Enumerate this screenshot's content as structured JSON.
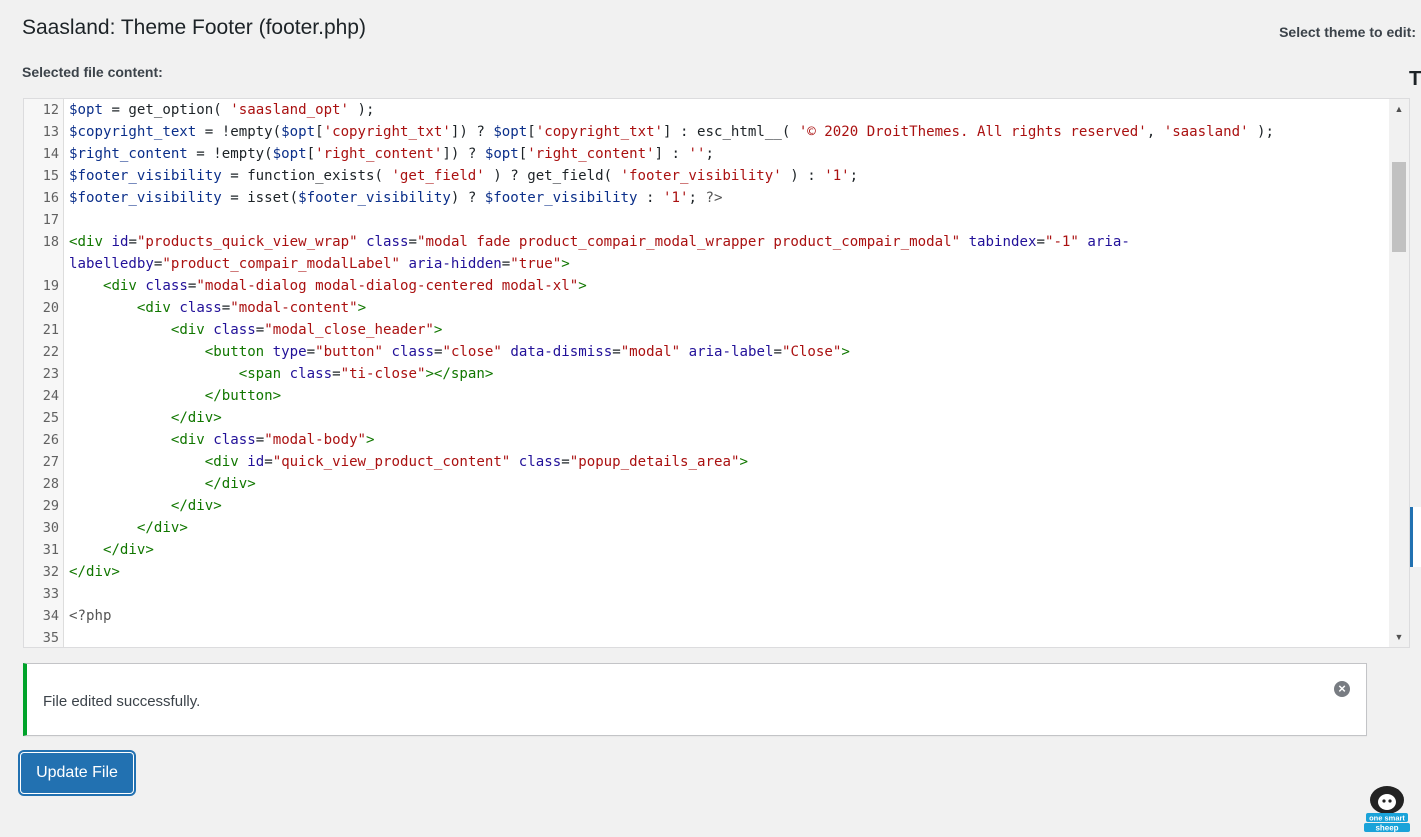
{
  "header": {
    "title": "Saasland: Theme Footer (footer.php)",
    "theme_select_label": "Select theme to edit:",
    "sidebar_heading_letter": "T"
  },
  "editor": {
    "label": "Selected file content:",
    "lines": [
      {
        "n": "12",
        "html": "<span class=\"v\">$opt</span> = get_option( <span class=\"s\">'saasland_opt'</span> );"
      },
      {
        "n": "13",
        "html": "<span class=\"v\">$copyright_text</span> = !empty(<span class=\"v\">$opt</span>[<span class=\"s\">'copyright_txt'</span>]) ? <span class=\"v\">$opt</span>[<span class=\"s\">'copyright_txt'</span>] : esc_html__( <span class=\"s\">'© 2020 DroitThemes. All rights reserved'</span>, <span class=\"s\">'saasland'</span> );"
      },
      {
        "n": "14",
        "html": "<span class=\"v\">$right_content</span> = !empty(<span class=\"v\">$opt</span>[<span class=\"s\">'right_content'</span>]) ? <span class=\"v\">$opt</span>[<span class=\"s\">'right_content'</span>] : <span class=\"s\">''</span>;"
      },
      {
        "n": "15",
        "html": "<span class=\"v\">$footer_visibility</span> = function_exists( <span class=\"s\">'get_field'</span> ) ? get_field( <span class=\"s\">'footer_visibility'</span> ) : <span class=\"s\">'1'</span>;"
      },
      {
        "n": "16",
        "html": "<span class=\"v\">$footer_visibility</span> = isset(<span class=\"v\">$footer_visibility</span>) ? <span class=\"v\">$footer_visibility</span> : <span class=\"s\">'1'</span>; <span class=\"m\">?&gt;</span>"
      },
      {
        "n": "17",
        "html": ""
      },
      {
        "n": "18",
        "tall": true,
        "html": "<span class=\"tg\">&lt;div</span> <span class=\"at\">id</span>=<span class=\"av\">\"products_quick_view_wrap\"</span> <span class=\"at\">class</span>=<span class=\"av\">\"modal fade product_compair_modal_wrapper product_compair_modal\"</span> <span class=\"at\">tabindex</span>=<span class=\"av\">\"-1\"</span> <span class=\"at\">aria-\nlabelledby</span>=<span class=\"av\">\"product_compair_modalLabel\"</span> <span class=\"at\">aria-hidden</span>=<span class=\"av\">\"true\"</span><span class=\"tg\">&gt;</span>"
      },
      {
        "n": "19",
        "html": "    <span class=\"tg\">&lt;div</span> <span class=\"at\">class</span>=<span class=\"av\">\"modal-dialog modal-dialog-centered modal-xl\"</span><span class=\"tg\">&gt;</span>"
      },
      {
        "n": "20",
        "html": "        <span class=\"tg\">&lt;div</span> <span class=\"at\">class</span>=<span class=\"av\">\"modal-content\"</span><span class=\"tg\">&gt;</span>"
      },
      {
        "n": "21",
        "html": "            <span class=\"tg\">&lt;div</span> <span class=\"at\">class</span>=<span class=\"av\">\"modal_close_header\"</span><span class=\"tg\">&gt;</span>"
      },
      {
        "n": "22",
        "html": "                <span class=\"tg\">&lt;button</span> <span class=\"at\">type</span>=<span class=\"av\">\"button\"</span> <span class=\"at\">class</span>=<span class=\"av\">\"close\"</span> <span class=\"at\">data-dismiss</span>=<span class=\"av\">\"modal\"</span> <span class=\"at\">aria-label</span>=<span class=\"av\">\"Close\"</span><span class=\"tg\">&gt;</span>"
      },
      {
        "n": "23",
        "html": "                    <span class=\"tg\">&lt;span</span> <span class=\"at\">class</span>=<span class=\"av\">\"ti-close\"</span><span class=\"tg\">&gt;&lt;/span&gt;</span>"
      },
      {
        "n": "24",
        "html": "                <span class=\"tg\">&lt;/button&gt;</span>"
      },
      {
        "n": "25",
        "html": "            <span class=\"tg\">&lt;/div&gt;</span>"
      },
      {
        "n": "26",
        "html": "            <span class=\"tg\">&lt;div</span> <span class=\"at\">class</span>=<span class=\"av\">\"modal-body\"</span><span class=\"tg\">&gt;</span>"
      },
      {
        "n": "27",
        "html": "                <span class=\"tg\">&lt;div</span> <span class=\"at\">id</span>=<span class=\"av\">\"quick_view_product_content\"</span> <span class=\"at\">class</span>=<span class=\"av\">\"popup_details_area\"</span><span class=\"tg\">&gt;</span>"
      },
      {
        "n": "28",
        "html": "                <span class=\"tg\">&lt;/div&gt;</span>"
      },
      {
        "n": "29",
        "html": "            <span class=\"tg\">&lt;/div&gt;</span>"
      },
      {
        "n": "30",
        "html": "        <span class=\"tg\">&lt;/div&gt;</span>"
      },
      {
        "n": "31",
        "html": "    <span class=\"tg\">&lt;/div&gt;</span>"
      },
      {
        "n": "32",
        "html": "<span class=\"tg\">&lt;/div&gt;</span>"
      },
      {
        "n": "33",
        "html": ""
      },
      {
        "n": "34",
        "html": "<span class=\"m\">&lt;?php</span>"
      },
      {
        "n": "35",
        "html": ""
      }
    ]
  },
  "notice": {
    "message": "File edited successfully.",
    "status_color": "#00a32a",
    "dismiss_icon": "close-circle-icon"
  },
  "actions": {
    "update_label": "Update File",
    "accent_color": "#2271b1"
  },
  "watermark": {
    "logo_text": "one smart sheep"
  }
}
